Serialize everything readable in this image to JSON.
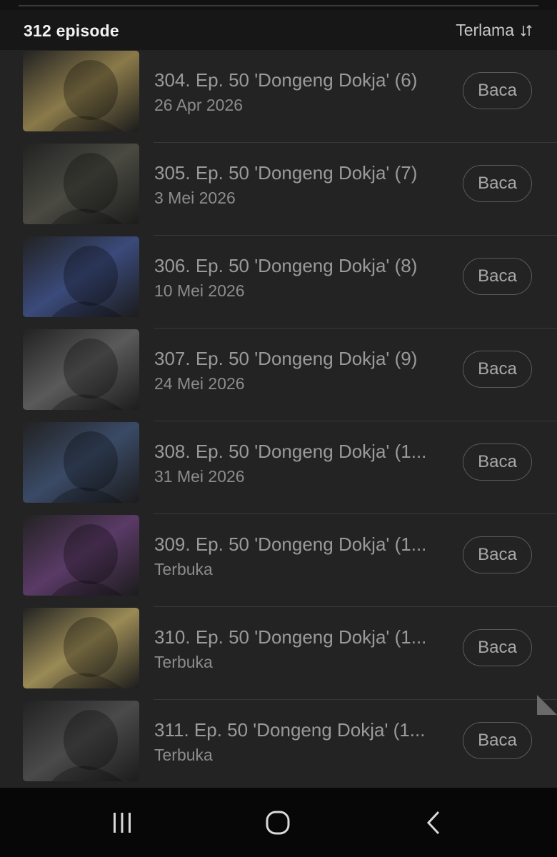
{
  "header": {
    "episode_count": "312 episode",
    "sort_label": "Terlama",
    "sort_icon": "sort-arrows-icon"
  },
  "episodes": [
    {
      "title": "304. Ep. 50 'Dongeng Dokja' (6)",
      "subtitle": "26 Apr 2026",
      "button": "Baca",
      "thumb_color": "#8a7a4a"
    },
    {
      "title": "305. Ep. 50 'Dongeng Dokja' (7)",
      "subtitle": "3 Mei 2026",
      "button": "Baca",
      "thumb_color": "#4a4a42"
    },
    {
      "title": "306. Ep. 50 'Dongeng Dokja' (8)",
      "subtitle": "10 Mei 2026",
      "button": "Baca",
      "thumb_color": "#3a4a7a"
    },
    {
      "title": "307. Ep. 50 'Dongeng Dokja' (9)",
      "subtitle": "24 Mei 2026",
      "button": "Baca",
      "thumb_color": "#5a5a5a"
    },
    {
      "title": "308. Ep. 50 'Dongeng Dokja' (1...",
      "subtitle": "31 Mei 2026",
      "button": "Baca",
      "thumb_color": "#3a4a66"
    },
    {
      "title": "309. Ep. 50 'Dongeng Dokja' (1...",
      "subtitle": "Terbuka",
      "button": "Baca",
      "thumb_color": "#5a3a66"
    },
    {
      "title": "310. Ep. 50 'Dongeng Dokja' (1...",
      "subtitle": "Terbuka",
      "button": "Baca",
      "thumb_color": "#9a8a55"
    },
    {
      "title": "311. Ep. 50 'Dongeng Dokja' (1...",
      "subtitle": "Terbuka",
      "button": "Baca",
      "thumb_color": "#4a4a4a"
    }
  ],
  "system_nav": {
    "recent_icon": "recent-apps-icon",
    "home_icon": "home-icon",
    "back_icon": "back-icon"
  }
}
